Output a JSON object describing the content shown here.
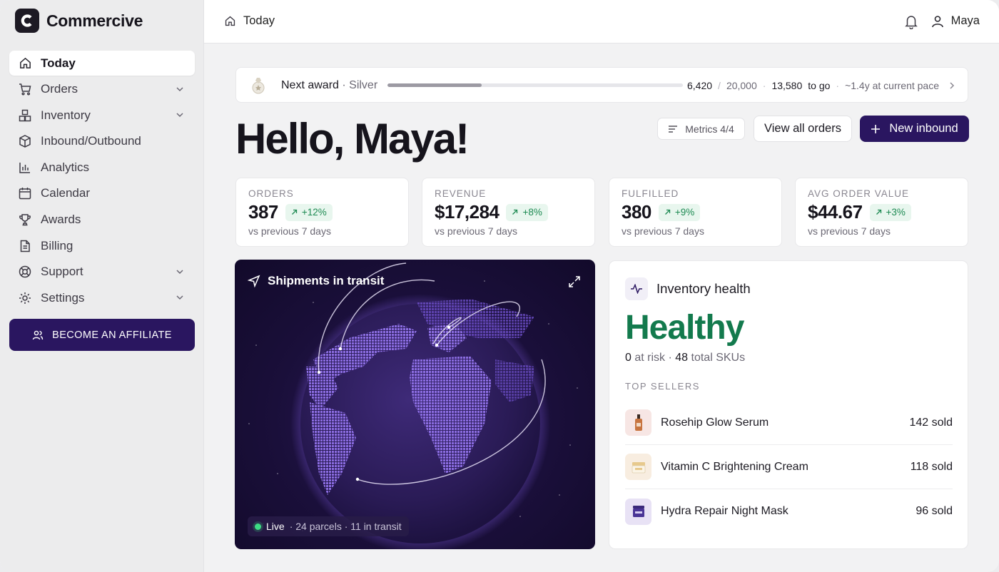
{
  "app": {
    "name": "Commercive"
  },
  "sidebar": {
    "items": [
      {
        "label": "Today",
        "icon": "home-icon",
        "active": true
      },
      {
        "label": "Orders",
        "icon": "cart-icon",
        "has_chevron": true
      },
      {
        "label": "Inventory",
        "icon": "boxes-icon",
        "has_chevron": true
      },
      {
        "label": "Inbound/Outbound",
        "icon": "package-icon"
      },
      {
        "label": "Analytics",
        "icon": "bar-chart-icon"
      },
      {
        "label": "Calendar",
        "icon": "calendar-icon"
      },
      {
        "label": "Awards",
        "icon": "trophy-icon"
      },
      {
        "label": "Billing",
        "icon": "document-icon"
      },
      {
        "label": "Support",
        "icon": "lifebuoy-icon",
        "has_chevron": true
      },
      {
        "label": "Settings",
        "icon": "gear-icon",
        "has_chevron": true
      }
    ],
    "affiliate_label": "BECOME AN AFFILIATE"
  },
  "topbar": {
    "breadcrumb": "Today",
    "user_name": "Maya"
  },
  "award": {
    "label": "Next award",
    "tier": "· Silver",
    "progress": 0.32,
    "current": "6,420",
    "separator": "/",
    "target": "20,000",
    "dot1": "·",
    "remaining": "13,580",
    "to_go": "to go",
    "dot2": "·",
    "pace": "~1.4y at current pace"
  },
  "greeting": "Hello, Maya!",
  "actions": {
    "metrics_label": "Metrics 4/4",
    "view_orders_label": "View all orders",
    "new_inbound_label": "New inbound"
  },
  "stats": [
    {
      "label": "ORDERS",
      "value": "387",
      "change": "+12%",
      "sub": "vs previous 7 days"
    },
    {
      "label": "REVENUE",
      "value": "$17,284",
      "change": "+8%",
      "sub": "vs previous 7 days"
    },
    {
      "label": "FULFILLED",
      "value": "380",
      "change": "+9%",
      "sub": "vs previous 7 days"
    },
    {
      "label": "AVG ORDER VALUE",
      "value": "$44.67",
      "change": "+3%",
      "sub": "vs previous 7 days"
    }
  ],
  "shipments": {
    "title": "Shipments in transit",
    "live_label": "Live",
    "live_detail": "· 24 parcels · 11 in transit"
  },
  "inventory": {
    "title": "Inventory health",
    "status": "Healthy",
    "at_risk": "0",
    "at_risk_label": "at risk ·",
    "total": "48",
    "total_label": "total SKUs",
    "top_sellers_label": "TOP SELLERS",
    "sellers": [
      {
        "name": "Rosehip Glow Serum",
        "sold": "142 sold"
      },
      {
        "name": "Vitamin C Brightening Cream",
        "sold": "118 sold"
      },
      {
        "name": "Hydra Repair Night Mask",
        "sold": "96 sold"
      }
    ]
  },
  "colors": {
    "brand": "#2a1660",
    "positive": "#1d8a52",
    "healthy": "#137a4d",
    "globe_bg": "#1a0f3a"
  }
}
